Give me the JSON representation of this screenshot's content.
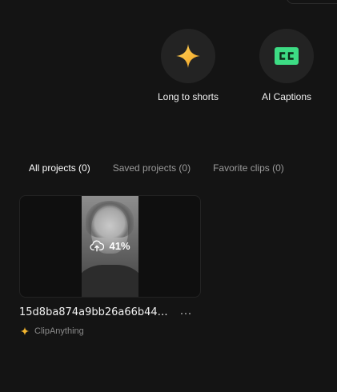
{
  "tools": [
    {
      "label": "Long to shorts",
      "icon": "sparkle-icon"
    },
    {
      "label": "AI Captions",
      "icon": "cc-icon"
    }
  ],
  "tabs": [
    {
      "label": "All projects (0)",
      "active": true
    },
    {
      "label": "Saved projects (0)",
      "active": false
    },
    {
      "label": "Favorite clips (0)",
      "active": false
    }
  ],
  "project": {
    "title": "15d8ba874a9bb26a66b44…",
    "progress_text": "41%",
    "progress": 0.41,
    "source_label": "ClipAnything",
    "source_icon": "sparkle-icon",
    "more_label": "…"
  },
  "colors": {
    "background": "#141414",
    "star": "#f2b52f",
    "cc_badge": "#3ddc84"
  }
}
